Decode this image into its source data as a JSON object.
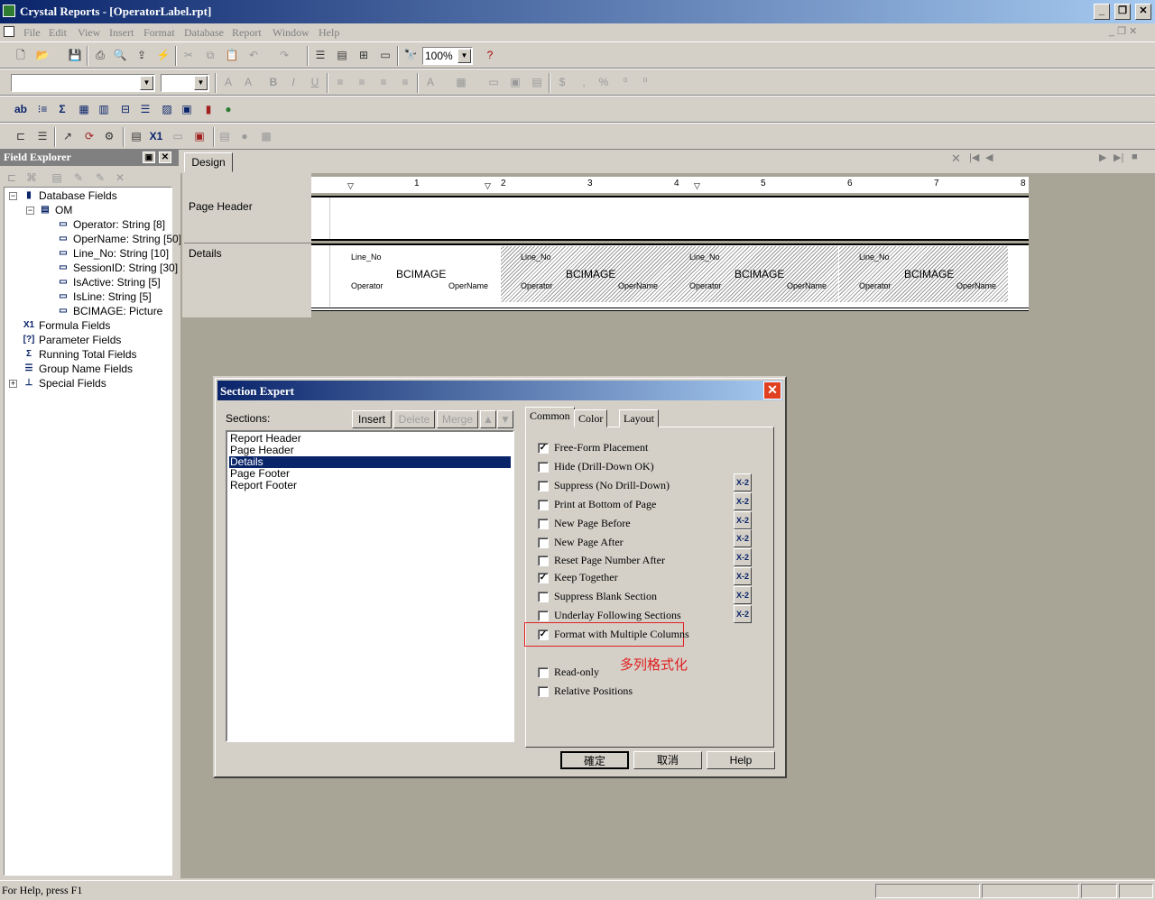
{
  "titlebar": {
    "title": "Crystal Reports - [OperatorLabel.rpt]"
  },
  "menu": {
    "items": [
      "File",
      "Edit",
      "View",
      "Insert",
      "Format",
      "Database",
      "Report",
      "Window",
      "Help"
    ]
  },
  "toolbar": {
    "zoom": "100%"
  },
  "field_explorer": {
    "title": "Field Explorer",
    "tree": {
      "database_fields": "Database Fields",
      "table": "OM",
      "fields": [
        "Operator: String [8]",
        "OperName: String [50]",
        "Line_No: String [10]",
        "SessionID: String [30]",
        "IsActive: String [5]",
        "IsLine: String [5]",
        "BCIMAGE: Picture"
      ],
      "formula_fields": "Formula Fields",
      "parameter_fields": "Parameter Fields",
      "running_total_fields": "Running Total Fields",
      "group_name_fields": "Group Name Fields",
      "special_fields": "Special Fields"
    }
  },
  "design": {
    "tab": "Design",
    "ruler_numbers": [
      "1",
      "2",
      "3",
      "4",
      "5",
      "6",
      "7",
      "8"
    ],
    "sections": {
      "page_header": "Page Header",
      "details": "Details"
    },
    "label": {
      "line_no": "Line_No",
      "image": "BCIMAGE",
      "operator": "Operator",
      "opername": "OperName"
    }
  },
  "dialog": {
    "title": "Section Expert",
    "sections_label": "Sections:",
    "buttons": {
      "insert": "Insert",
      "delete": "Delete",
      "merge": "Merge",
      "ok": "確定",
      "cancel": "取消",
      "help": "Help"
    },
    "sections": [
      "Report Header",
      "Page Header",
      "Details",
      "Page Footer",
      "Report Footer"
    ],
    "selected_section": "Details",
    "tabs": [
      "Common",
      "Color",
      "Layout"
    ],
    "options": [
      {
        "label": "Free-Form Placement",
        "checked": true
      },
      {
        "label": "Hide (Drill-Down OK)",
        "checked": false
      },
      {
        "label": "Suppress (No Drill-Down)",
        "checked": false
      },
      {
        "label": "Print at Bottom of Page",
        "checked": false
      },
      {
        "label": "New Page Before",
        "checked": false
      },
      {
        "label": "New Page After",
        "checked": false
      },
      {
        "label": "Reset Page Number After",
        "checked": false
      },
      {
        "label": "Keep Together",
        "checked": true
      },
      {
        "label": "Suppress Blank Section",
        "checked": false
      },
      {
        "label": "Underlay Following Sections",
        "checked": false
      },
      {
        "label": "Format with Multiple Columns",
        "checked": true
      },
      {
        "label": "Read-only",
        "checked": false
      },
      {
        "label": "Relative Positions",
        "checked": false
      }
    ],
    "annotation": "多列格式化",
    "formula_button": "X-2",
    "annotation_color": "#e02020"
  },
  "statusbar": {
    "text": "For Help, press F1"
  }
}
